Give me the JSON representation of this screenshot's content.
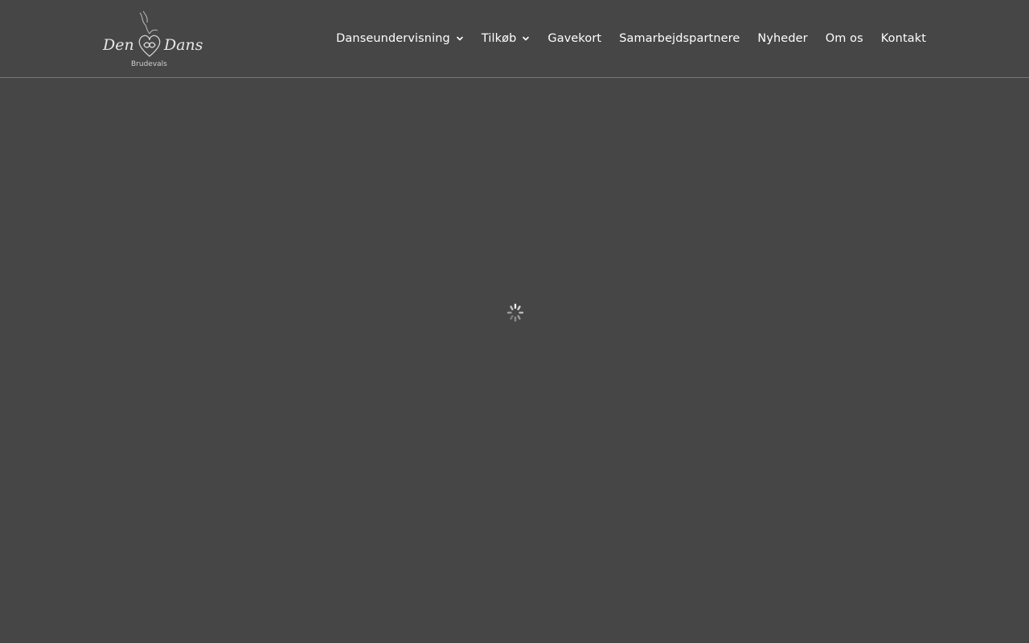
{
  "logo": {
    "word_left": "Den",
    "word_right": "Dans",
    "subtitle": "Brudevals"
  },
  "nav": {
    "items": [
      {
        "label": "Danseundervisning",
        "has_submenu": true
      },
      {
        "label": "Tilkøb",
        "has_submenu": true
      },
      {
        "label": "Gavekort",
        "has_submenu": false
      },
      {
        "label": "Samarbejdspartnere",
        "has_submenu": false
      },
      {
        "label": "Nyheder",
        "has_submenu": false
      },
      {
        "label": "Om os",
        "has_submenu": false
      },
      {
        "label": "Kontakt",
        "has_submenu": false
      }
    ]
  },
  "icons": {
    "submenu": "chevron-down-icon",
    "loader": "loading-spinner-icon"
  },
  "colors": {
    "background": "#464646",
    "header_border": "#777777",
    "nav_text": "#ffffff"
  }
}
